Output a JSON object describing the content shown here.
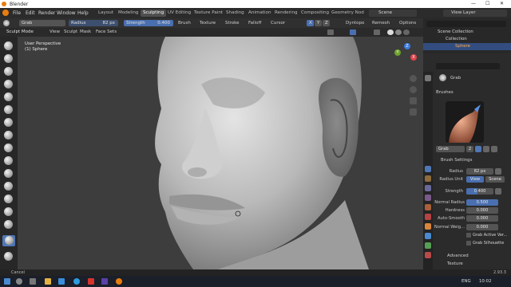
{
  "window": {
    "title": "Blender",
    "controls": [
      "—",
      "☐",
      "✕"
    ]
  },
  "menubar": {
    "items": [
      "File",
      "Edit",
      "Render",
      "Window",
      "Help"
    ],
    "workspaces": [
      "Layout",
      "Modeling",
      "Sculpting",
      "UV Editing",
      "Texture Paint",
      "Shading",
      "Animation",
      "Rendering",
      "Compositing",
      "Geometry Nod"
    ],
    "active_workspace": "Sculpting",
    "scene_label": "Scene",
    "view_layer_label": "View Layer"
  },
  "tool_settings": {
    "tool_name": "Grab",
    "radius_label": "Radius",
    "radius_value": "82 px",
    "strength_label": "Strength",
    "strength_value": "0.400",
    "menus": [
      "Brush",
      "Texture",
      "Stroke",
      "Falloff",
      "Cursor"
    ],
    "axes": [
      "X",
      "Y",
      "Z"
    ],
    "dyntopo": "Dyntopo",
    "remesh": "Remesh",
    "options": "Options"
  },
  "header2": {
    "mode": "Sculpt Mode",
    "menus": [
      "View",
      "Sculpt",
      "Mask",
      "Face Sets"
    ]
  },
  "viewport": {
    "perspective": "User Perspective",
    "object": "(1) Sphere",
    "gizmo_axes": [
      "X",
      "Y",
      "Z"
    ]
  },
  "outliner": {
    "root": "Scene Collection",
    "collection": "Collection",
    "object": "Sphere"
  },
  "properties": {
    "tool_header": "Grab",
    "brushes_section": "Brushes",
    "brush_name": "Grab",
    "brush_users": "2",
    "brush_settings_section": "Brush Settings",
    "radius_label": "Radius",
    "radius_value": "82 px",
    "radius_unit_label": "Radius Unit",
    "radius_unit_options": [
      "View",
      "Scene"
    ],
    "radius_unit_selected": "View",
    "strength_label": "Strength",
    "strength_value": "0.400",
    "strength_fraction": 0.4,
    "normal_radius_label": "Normal Radius",
    "normal_radius_value": "0.500",
    "hardness_label": "Hardness",
    "hardness_value": "0.000",
    "auto_smooth_label": "Auto-Smooth",
    "auto_smooth_value": "0.000",
    "normal_weight_label": "Normal Weig...",
    "normal_weight_value": "0.000",
    "checkbox_active_vertex": "Grab Active Ver...",
    "checkbox_silhouette": "Grab Silhouette",
    "advanced_section": "Advanced",
    "texture_section": "Texture"
  },
  "statusbar": {
    "left_text": "Cancel",
    "version": "2.93.3"
  },
  "taskbar": {
    "language": "ENG",
    "time": "10:02"
  },
  "colors": {
    "accent_blue": "#4a6fb0",
    "active_tab": "#4f4f4f",
    "blender_orange": "#e87d0d"
  }
}
